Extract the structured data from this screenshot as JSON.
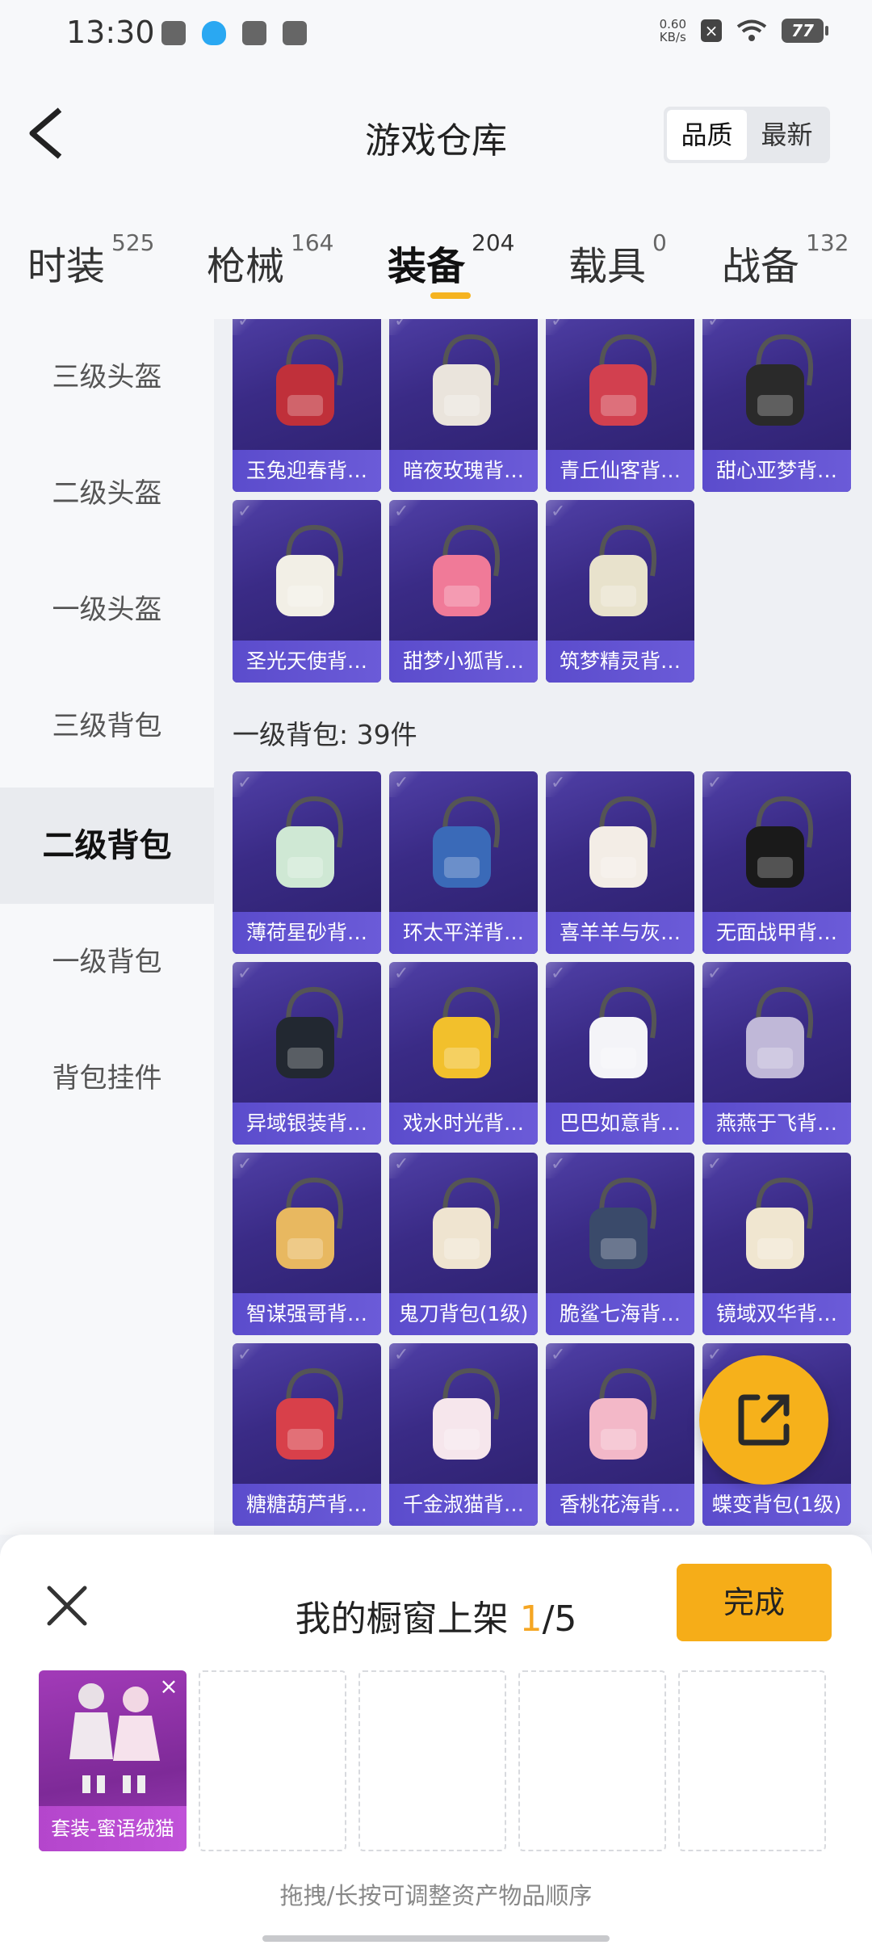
{
  "status_bar": {
    "time": "13:30",
    "net_speed_value": "0.60",
    "net_speed_unit": "KB/s",
    "battery": "77"
  },
  "header": {
    "title": "游戏仓库",
    "sort_options": [
      "品质",
      "最新"
    ]
  },
  "tabs": [
    {
      "label": "时装",
      "count": "525"
    },
    {
      "label": "枪械",
      "count": "164"
    },
    {
      "label": "装备",
      "count": "204"
    },
    {
      "label": "载具",
      "count": "0"
    },
    {
      "label": "战备",
      "count": "132"
    }
  ],
  "sidebar": {
    "items": [
      "三级头盔",
      "二级头盔",
      "一级头盔",
      "三级背包",
      "二级背包",
      "一级背包",
      "背包挂件"
    ]
  },
  "top_grid": {
    "items": [
      {
        "name": "玉兔迎春背…",
        "color": "#c0303a"
      },
      {
        "name": "暗夜玫瑰背…",
        "color": "#eae4dc"
      },
      {
        "name": "青丘仙客背…",
        "color": "#d2404f"
      },
      {
        "name": "甜心亚梦背…",
        "color": "#2a2a2a"
      },
      {
        "name": "圣光天使背…",
        "color": "#f2efe6"
      },
      {
        "name": "甜梦小狐背…",
        "color": "#f07a98"
      },
      {
        "name": "筑梦精灵背…",
        "color": "#e8e2cc"
      }
    ]
  },
  "section": {
    "label": "一级背包: 39件"
  },
  "bottom_grid": {
    "items": [
      {
        "name": "薄荷星砂背…",
        "color": "#cfe8d4"
      },
      {
        "name": "环太平洋背…",
        "color": "#3a6ab8"
      },
      {
        "name": "喜羊羊与灰…",
        "color": "#f3ede6"
      },
      {
        "name": "无面战甲背…",
        "color": "#1a1a1a"
      },
      {
        "name": "异域银装背…",
        "color": "#222831"
      },
      {
        "name": "戏水时光背…",
        "color": "#f2c02c"
      },
      {
        "name": "巴巴如意背…",
        "color": "#f4f4f8"
      },
      {
        "name": "燕燕于飞背…",
        "color": "#c0b8d8"
      },
      {
        "name": "智谋强哥背…",
        "color": "#e8b860"
      },
      {
        "name": "鬼刀背包(1级)",
        "color": "#efe4d0"
      },
      {
        "name": "脆鲨七海背…",
        "color": "#3a4a6a"
      },
      {
        "name": "镜域双华背…",
        "color": "#f0e6d0"
      },
      {
        "name": "糖糖葫芦背…",
        "color": "#d8404a"
      },
      {
        "name": "千金淑猫背…",
        "color": "#f6e6ec"
      },
      {
        "name": "香桃花海背…",
        "color": "#f3b8c8"
      },
      {
        "name": "蝶变背包(1级)",
        "color": "#d06ab0"
      }
    ]
  },
  "panel": {
    "title_prefix": "我的橱窗上架 ",
    "current": "1",
    "total": "/5",
    "done_label": "完成",
    "filled_slot_name": "套装-蜜语绒猫",
    "hint": "拖拽/长按可调整资产物品顺序"
  },
  "colors": {
    "accent": "#f6ad18",
    "card_bg": "#3a2b86",
    "slot_bg": "#8a2fa8"
  }
}
